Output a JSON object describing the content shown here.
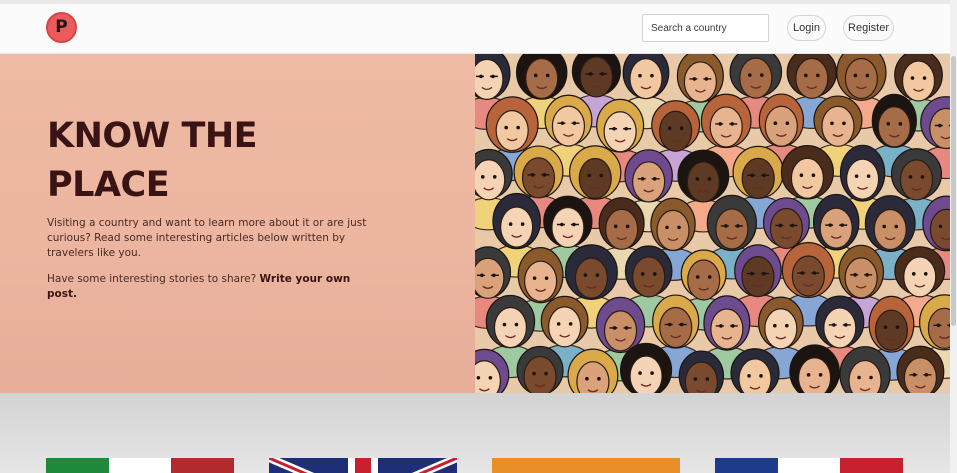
{
  "navbar": {
    "logo_letter": "P",
    "search_placeholder": "Search a country",
    "login_label": "Login",
    "register_label": "Register"
  },
  "hero": {
    "title": "KNOW THE PLACE",
    "description": "Visiting a country and want to learn more about it or are just curious? Read some interesting articles below written by travelers like you.",
    "share_prefix": "Have some interesting stories to share? ",
    "share_link": "Write your own post.",
    "image_icon": "crowd-of-diverse-faces-illustration"
  },
  "country_cards": [
    {
      "flag_icon": "italy-flag-icon",
      "colors": [
        "#1f8a3c",
        "#ffffff",
        "#b2292e"
      ]
    },
    {
      "flag_icon": "uk-flag-icon",
      "colors": [
        "#1e2f78",
        "#ffffff",
        "#c8202f"
      ]
    },
    {
      "flag_icon": "india-flag-icon",
      "colors": [
        "#e88f2a"
      ]
    },
    {
      "flag_icon": "france-flag-icon",
      "colors": [
        "#1e3a8a",
        "#ffffff",
        "#c8202f"
      ]
    }
  ],
  "colors": {
    "brand_red": "#ec5b5b",
    "hero_background": "#eebaa4",
    "hero_text": "#3a1414"
  }
}
